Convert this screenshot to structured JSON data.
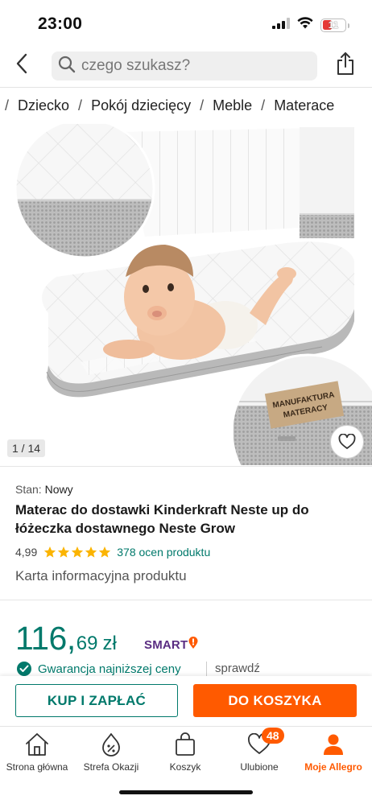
{
  "status_bar": {
    "time": "23:00",
    "battery_level": "11",
    "battery_color": "#e53935"
  },
  "search": {
    "placeholder": "czego szukasz?",
    "back_icon": "chevron-left-icon",
    "search_icon": "magnifier-icon",
    "share_icon": "share-icon"
  },
  "breadcrumb": [
    "Dziecko",
    "Pokój dziecięcy",
    "Meble",
    "Materace"
  ],
  "gallery": {
    "counter": "1 / 14",
    "brand_label_line1": "MANUFAKTURA",
    "brand_label_line2": "MATERACY"
  },
  "product": {
    "condition_label": "Stan:",
    "condition_value": "Nowy",
    "title": "Materac do dostawki Kinderkraft Neste up do łóżeczka dostawnego Neste Grow",
    "rating_value": "4,99",
    "stars": 5,
    "rating_count": "378 ocen produktu",
    "info_card_link": "Karta informacyjna produktu"
  },
  "price": {
    "integer": "116,",
    "decimal": "69",
    "currency": "zł",
    "smart_label": "SMART",
    "guarantee": "Gwarancja najniższej ceny",
    "verify": "sprawdź"
  },
  "actions": {
    "buy_now": "KUP I ZAPŁAĆ",
    "add_to_cart": "DO KOSZYKA"
  },
  "bottom_nav": {
    "items": [
      {
        "label": "Strona główna",
        "icon": "home-icon"
      },
      {
        "label": "Strefa Okazji",
        "icon": "discount-icon"
      },
      {
        "label": "Koszyk",
        "icon": "shopping-bag-icon"
      },
      {
        "label": "Ulubione",
        "icon": "heart-icon",
        "badge": "48"
      },
      {
        "label": "Moje Allegro",
        "icon": "user-icon",
        "active": true
      }
    ]
  },
  "colors": {
    "accent_orange": "#ff5a00",
    "brand_green": "#00796b",
    "smart_purple": "#5a2d82",
    "star_yellow": "#fbb400"
  }
}
